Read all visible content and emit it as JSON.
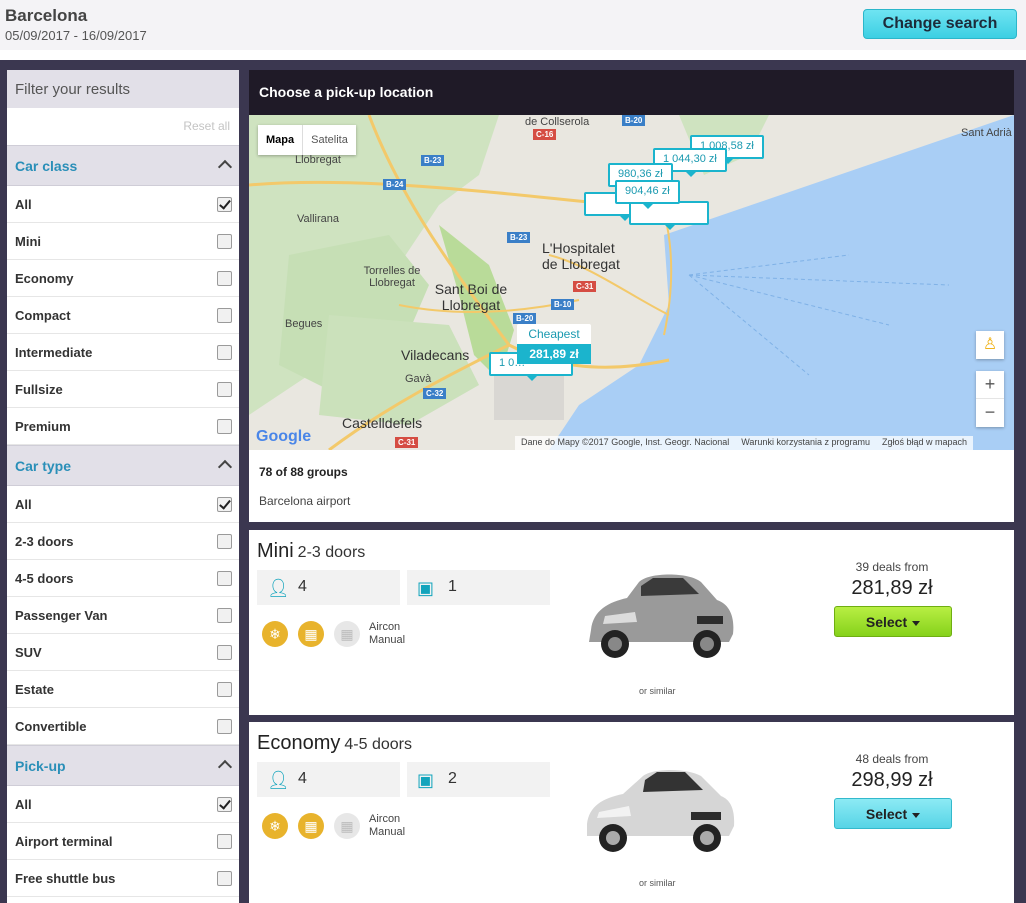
{
  "header": {
    "city": "Barcelona",
    "dates": "05/09/2017 - 16/09/2017",
    "change_search_label": "Change search"
  },
  "sidebar": {
    "title": "Filter your results",
    "reset_label": "Reset all",
    "sections": [
      {
        "title": "Car class",
        "options": [
          {
            "label": "All",
            "checked": true
          },
          {
            "label": "Mini",
            "checked": false
          },
          {
            "label": "Economy",
            "checked": false
          },
          {
            "label": "Compact",
            "checked": false
          },
          {
            "label": "Intermediate",
            "checked": false
          },
          {
            "label": "Fullsize",
            "checked": false
          },
          {
            "label": "Premium",
            "checked": false
          }
        ]
      },
      {
        "title": "Car type",
        "options": [
          {
            "label": "All",
            "checked": true
          },
          {
            "label": "2-3 doors",
            "checked": false
          },
          {
            "label": "4-5 doors",
            "checked": false
          },
          {
            "label": "Passenger Van",
            "checked": false
          },
          {
            "label": "SUV",
            "checked": false
          },
          {
            "label": "Estate",
            "checked": false
          },
          {
            "label": "Convertible",
            "checked": false
          }
        ]
      },
      {
        "title": "Pick-up",
        "options": [
          {
            "label": "All",
            "checked": true
          },
          {
            "label": "Airport terminal",
            "checked": false
          },
          {
            "label": "Free shuttle bus",
            "checked": false
          }
        ]
      }
    ]
  },
  "map": {
    "title": "Choose a pick-up location",
    "type_map": "Mapa",
    "type_satellite": "Satelita",
    "zoom_in": "+",
    "zoom_out": "−",
    "google": "Google",
    "attribution_data": "Dane do Mapy ©2017 Google, Inst. Geogr. Nacional",
    "attribution_terms": "Warunki korzystania z programu",
    "attribution_report": "Zgłoś błąd w mapach",
    "cheapest_label": "Cheapest",
    "cheapest_price": "281,89 zł",
    "price_markers": [
      "1 008,58 zł",
      "1 044,30 zł",
      "980,36 zł",
      "904,46 zł",
      "1 0…"
    ],
    "place_labels": [
      "de Collserola",
      "Llobregat",
      "Vallirana",
      "L'Hospitalet de Llobregat",
      "Torrelles de Llobregat",
      "Sant Boi de Llobregat",
      "Begues",
      "Viladecans",
      "Gavà",
      "Castelldefels",
      "Sant Adrià"
    ],
    "road_labels": [
      "B-20",
      "C-16",
      "B-23",
      "B-24",
      "B-23",
      "C-31",
      "B-10",
      "B-20",
      "C-32",
      "C-31"
    ],
    "groups_count": "78 of 88 groups",
    "location": "Barcelona airport"
  },
  "cars": [
    {
      "class": "Mini",
      "doors": "2-3 doors",
      "passengers": "4",
      "bags": "1",
      "features": [
        "Aircon",
        "Manual"
      ],
      "similar": "or similar",
      "deals": "39 deals from",
      "price": "281,89 zł",
      "select_label": "Select"
    },
    {
      "class": "Economy",
      "doors": "4-5 doors",
      "passengers": "4",
      "bags": "2",
      "features": [
        "Aircon",
        "Manual"
      ],
      "similar": "or similar",
      "deals": "48 deals from",
      "price": "298,99 zł",
      "select_label": "Select"
    }
  ],
  "colors": {
    "accent": "#2a8fb8",
    "map_marker": "#1bb4cd",
    "select_green": "#86d21b",
    "select_blue": "#56d4e6",
    "feature_gold": "#e8b32c",
    "frame": "#3b3750"
  }
}
